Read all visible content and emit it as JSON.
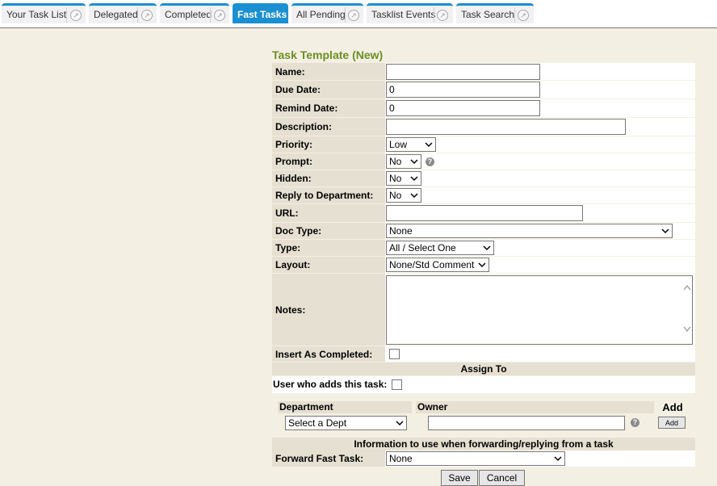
{
  "tabs": [
    {
      "label": "Your Task List",
      "active": false
    },
    {
      "label": "Delegated",
      "active": false
    },
    {
      "label": "Completed",
      "active": false
    },
    {
      "label": "Fast Tasks",
      "active": true
    },
    {
      "label": "All Pending",
      "active": false
    },
    {
      "label": "Tasklist Events",
      "active": false
    },
    {
      "label": "Task Search",
      "active": false
    }
  ],
  "form": {
    "title": "Task Template (New)",
    "fields": {
      "name": {
        "label": "Name:",
        "value": ""
      },
      "due_date": {
        "label": "Due Date:",
        "value": "0"
      },
      "remind_date": {
        "label": "Remind Date:",
        "value": "0"
      },
      "description": {
        "label": "Description:",
        "value": ""
      },
      "priority": {
        "label": "Priority:",
        "value": "Low"
      },
      "prompt": {
        "label": "Prompt:",
        "value": "No"
      },
      "hidden": {
        "label": "Hidden:",
        "value": "No"
      },
      "reply_to_department": {
        "label": "Reply to Department:",
        "value": "No"
      },
      "url": {
        "label": "URL:",
        "value": ""
      },
      "doc_type": {
        "label": "Doc Type:",
        "value": "None"
      },
      "type": {
        "label": "Type:",
        "value": "All / Select One"
      },
      "layout": {
        "label": "Layout:",
        "value": "None/Std Comment"
      },
      "notes": {
        "label": "Notes:",
        "value": ""
      },
      "insert_as_completed": {
        "label": "Insert As Completed:",
        "checked": false
      }
    },
    "assign_to": {
      "heading": "Assign To",
      "user_who_adds_label": "User who adds this task:",
      "user_who_adds_checked": false,
      "columns": {
        "department": "Department",
        "owner": "Owner",
        "add": "Add"
      },
      "department_value": "Select a Dept",
      "owner_value": "",
      "add_button": "Add"
    },
    "forwarding": {
      "heading": "Information to use when forwarding/replying from a task",
      "label": "Forward Fast Task:",
      "value": "None"
    },
    "buttons": {
      "save": "Save",
      "cancel": "Cancel"
    }
  }
}
